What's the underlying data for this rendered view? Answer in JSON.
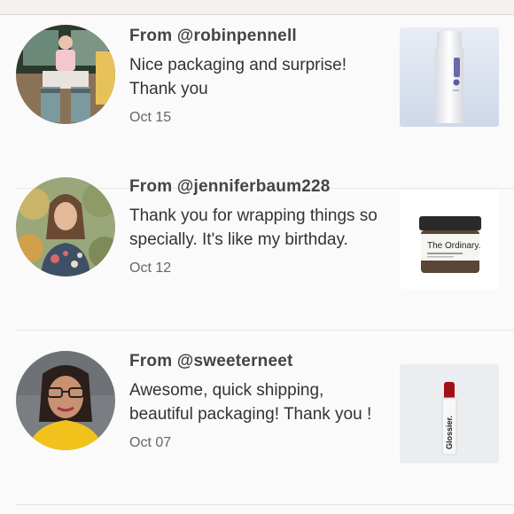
{
  "reviews": [
    {
      "from": "From @robinpennell",
      "comment": "Nice packaging and surprise! Thank you",
      "date": "Oct 15",
      "avatar_icon": "user-photo-icon",
      "product_icon": "serum-bottle-icon"
    },
    {
      "from": "From @jenniferbaum228",
      "comment": "Thank you for wrapping things so specially. It's like my birthday.",
      "date": "Oct 12",
      "avatar_icon": "user-photo-icon",
      "product_icon": "cream-jar-icon",
      "product_text": {
        "brand": "The Ordinary."
      }
    },
    {
      "from": "From @sweeterneet",
      "comment": "Awesome, quick shipping, beautiful packaging! Thank you !",
      "date": "Oct 07",
      "avatar_icon": "user-photo-icon",
      "product_icon": "lipstick-icon",
      "product_text": {
        "brand": "Glossier."
      }
    }
  ],
  "colors": {
    "background": "#fbfafa",
    "divider": "#e9e6e3",
    "text": "#333333",
    "muted": "#666666"
  }
}
